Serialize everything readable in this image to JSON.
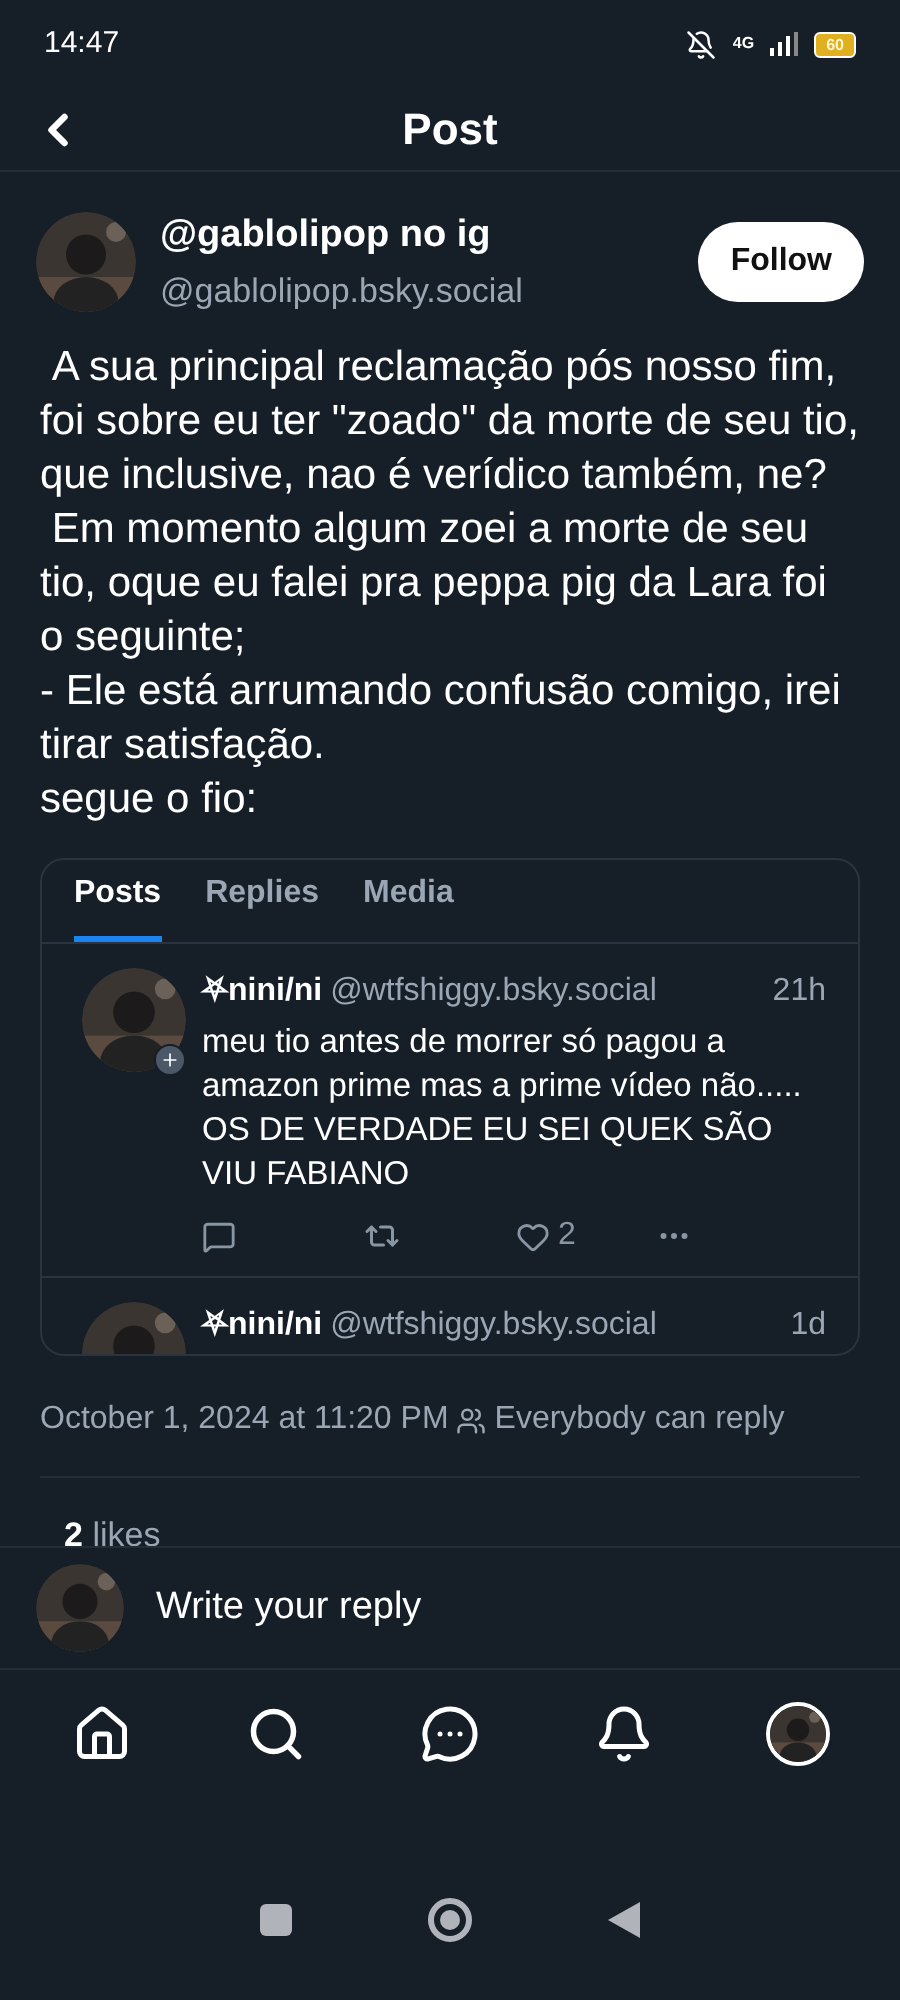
{
  "status_bar": {
    "time": "14:47",
    "network": "4G",
    "battery": "60"
  },
  "header": {
    "title": "Post"
  },
  "post": {
    "display_name": "@gablolipop no ig",
    "handle": "@gablolipop.bsky.social",
    "follow_label": "Follow",
    "text": " A sua principal reclamação pós nosso fim, foi sobre eu ter \"zoado\" da morte de seu tio, que inclusive, nao é verídico também, ne?\n Em momento algum zoei a morte de seu tio, oque eu falei pra peppa pig da Lara foi o seguinte;\n- Ele está arrumando confusão comigo, irei tirar satisfação.\nsegue o fio:",
    "embed": {
      "tabs": [
        {
          "label": "Posts",
          "selected": true
        },
        {
          "label": "Replies",
          "selected": false
        },
        {
          "label": "Media",
          "selected": false
        }
      ],
      "posts": [
        {
          "name": "⛧nini/ni",
          "handle": "@wtfshiggy.bsky.social",
          "time": "21h",
          "text": "meu tio antes de morrer só pagou a amazon prime mas a prime vídeo não..... OS DE VERDADE EU SEI QUEK SÃO VIU FABIANO",
          "likes": "2"
        },
        {
          "name": "⛧nini/ni",
          "handle": "@wtfshiggy.bsky.social",
          "time": "1d"
        }
      ]
    },
    "timestamp": "October 1, 2024 at 11:20 PM",
    "reply_setting": "Everybody can reply",
    "likes": "**2** likes"
  },
  "reply_bar": {
    "placeholder": "Write your reply"
  }
}
